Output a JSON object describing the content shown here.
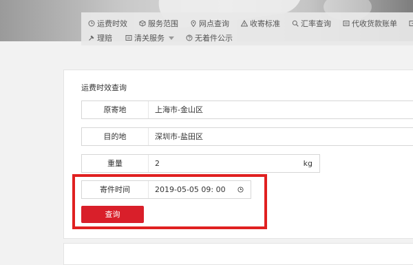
{
  "nav": {
    "items": [
      {
        "label": "运费时效",
        "icon": "clock-icon"
      },
      {
        "label": "服务范围",
        "icon": "package-icon"
      },
      {
        "label": "网点查询",
        "icon": "location-pin-icon"
      },
      {
        "label": "收寄标准",
        "icon": "warning-icon"
      },
      {
        "label": "汇率查询",
        "icon": "search-icon"
      },
      {
        "label": "代收货款账单",
        "icon": "bill-icon"
      },
      {
        "label": "理赔",
        "icon": "hammer-icon"
      },
      {
        "label": "清关服务",
        "icon": "customs-icon"
      },
      {
        "label": "无着件公示",
        "icon": "question-icon"
      }
    ]
  },
  "form": {
    "title": "运费时效查询",
    "origin": {
      "label": "原寄地",
      "value": "上海市-金山区"
    },
    "destination": {
      "label": "目的地",
      "value": "深圳市-盐田区"
    },
    "weight": {
      "label": "重量",
      "value": "2",
      "unit": "kg"
    },
    "send_time": {
      "label": "寄件时间",
      "value": "2019-05-05 09: 00"
    },
    "submit_label": "查询"
  },
  "colors": {
    "accent": "#d91f2a",
    "highlight": "#e02020"
  }
}
